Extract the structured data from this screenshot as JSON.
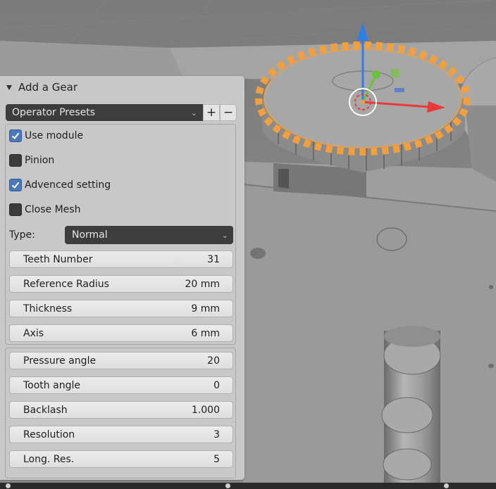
{
  "panel": {
    "title": "Add a Gear",
    "presets": {
      "label": "Operator Presets",
      "add": "+",
      "remove": "−"
    },
    "checkboxes": [
      {
        "label": "Use module",
        "checked": true
      },
      {
        "label": "Pinion",
        "checked": false
      },
      {
        "label": "Advenced setting",
        "checked": true
      },
      {
        "label": "Close Mesh",
        "checked": false
      }
    ],
    "type": {
      "label": "Type:",
      "value": "Normal"
    },
    "fields": [
      {
        "label": "Teeth Number",
        "value": "31"
      },
      {
        "label": "Reference Radius",
        "value": "20 mm"
      },
      {
        "label": "Thickness",
        "value": "9 mm"
      },
      {
        "label": "Axis",
        "value": "6 mm"
      }
    ],
    "advanced_fields": [
      {
        "label": "Pressure angle",
        "value": "20"
      },
      {
        "label": "Tooth angle",
        "value": "0"
      },
      {
        "label": "Backlash",
        "value": "1.000"
      },
      {
        "label": "Resolution",
        "value": "3"
      },
      {
        "label": "Long. Res.",
        "value": "5"
      }
    ]
  },
  "colors": {
    "accent": "#4a78b8",
    "selection_outline": "#f0a040",
    "gizmo_z": "#2f7ee8",
    "gizmo_x": "#e83a3a",
    "gizmo_y": "#6cc040"
  },
  "icons": [
    "disclosure-triangle-icon",
    "chevron-down-icon",
    "checkmark-icon",
    "3d-cursor-icon"
  ]
}
